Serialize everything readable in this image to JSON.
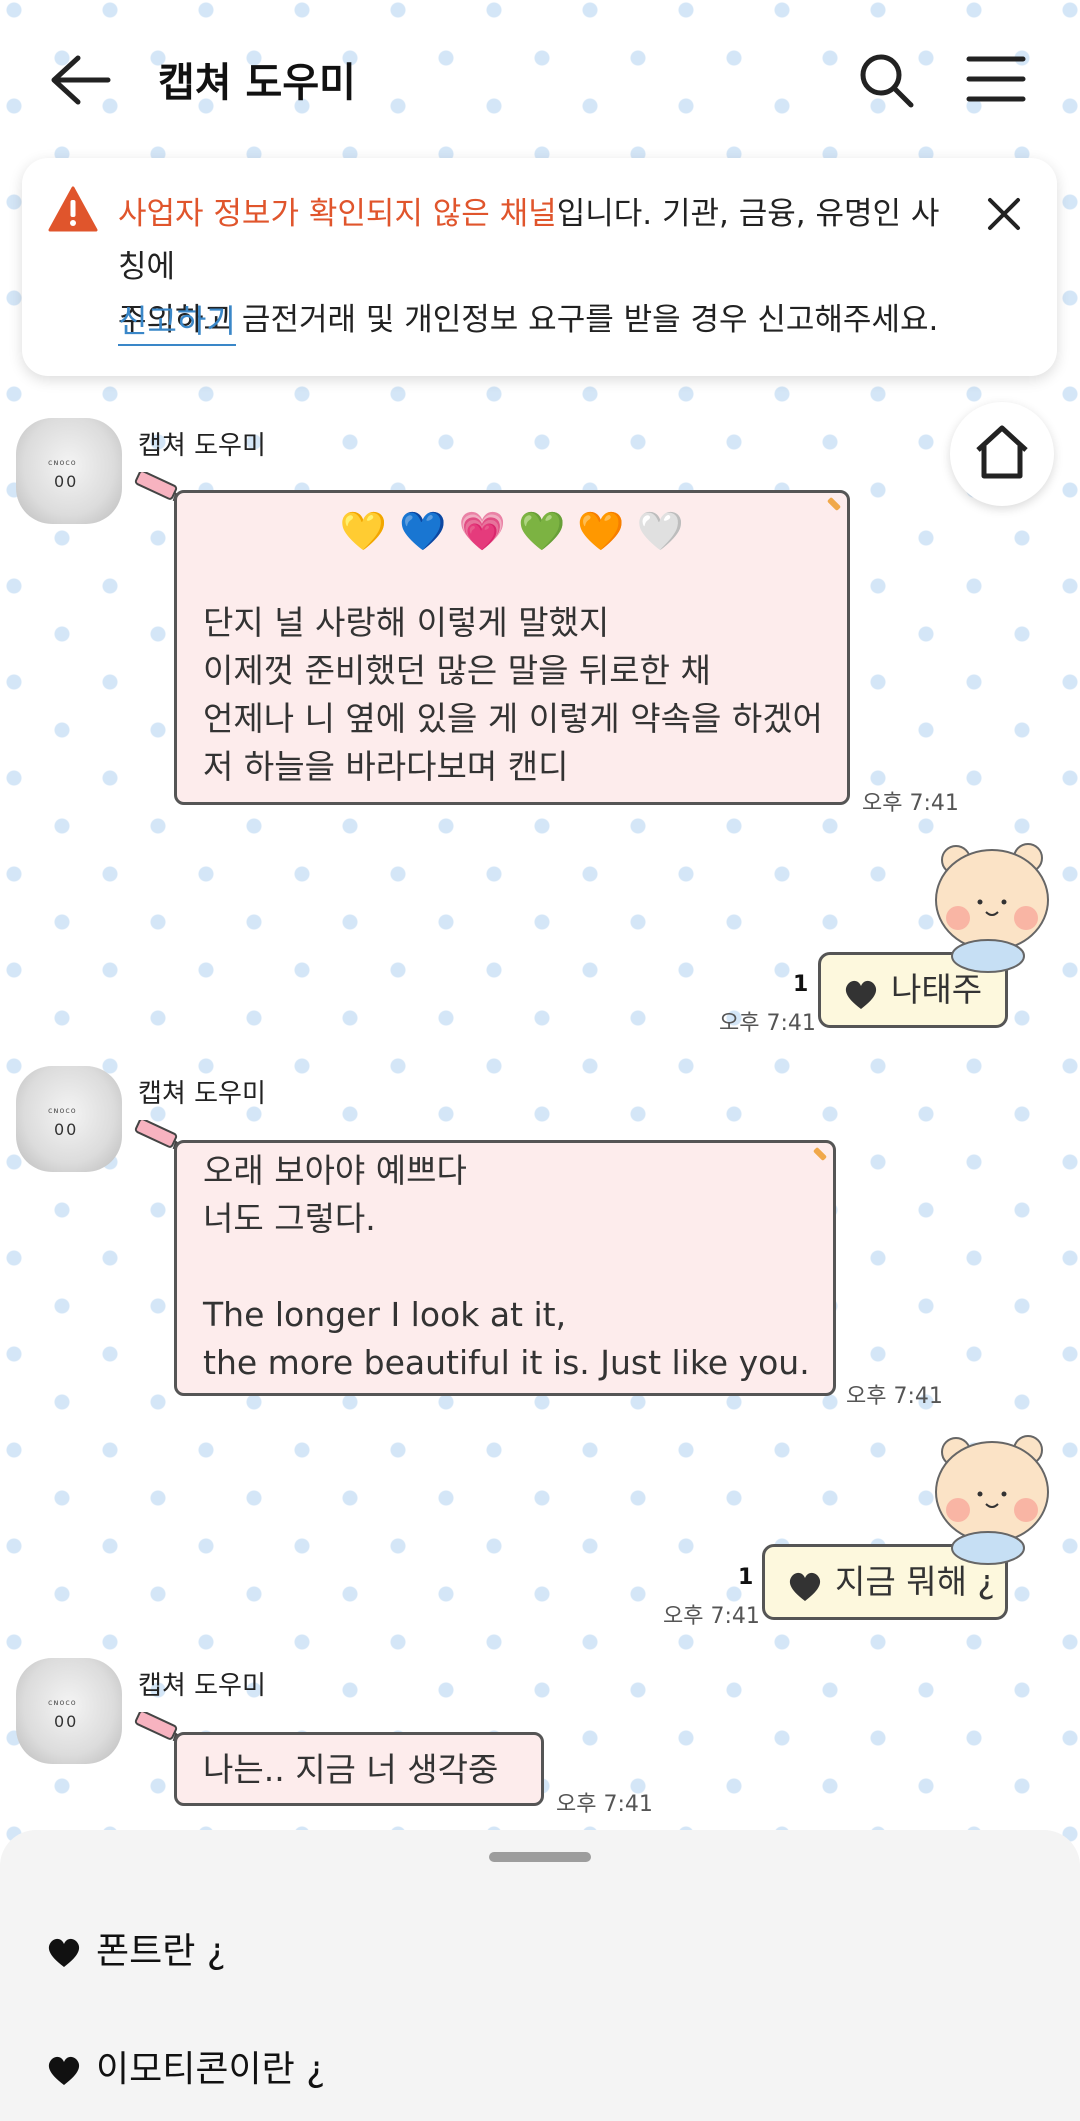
{
  "header": {
    "title": "캡쳐 도우미"
  },
  "notice": {
    "highlight": "사업자 정보가 확인되지 않은 채널",
    "text_line1_rest": "입니다. 기관, 금융, 유명인 사칭에",
    "text_line2": "주의하고 금전거래 및 개인정보 요구를 받을 경우 신고해주세요.",
    "report_label": "신고하기"
  },
  "messages": [
    {
      "sender": "캡쳐 도우미",
      "emoji_row": "💛 💙 💗 💚 🧡 🤍",
      "lines": [
        "단지 널 사랑해 이렇게 말했지",
        "이제껏 준비했던 많은 말을 뒤로한 채",
        "언제나 니 옆에 있을 게 이렇게 약속을 하겠어",
        "저 하늘을 바라다보며 캔디"
      ],
      "time": "오후 7:41"
    },
    {
      "text": "나태주",
      "time": "오후 7:41",
      "unread": "1"
    },
    {
      "sender": "캡쳐 도우미",
      "lines": [
        "오래 보아야 예쁘다",
        "너도 그렇다.",
        "",
        "The longer I look at it,",
        "the more beautiful it is. Just like you."
      ],
      "time": "오후 7:41"
    },
    {
      "text": "지금 뭐해 ¿",
      "time": "오후 7:41",
      "unread": "1"
    },
    {
      "sender": "캡쳐 도우미",
      "text": "나는.. 지금 너 생각중 >_<",
      "time": "오후 7:41"
    }
  ],
  "avatar": {
    "brand": "ᴄɴᴏᴄᴏ",
    "eyes": "00"
  },
  "sheet": {
    "items": [
      "폰트란 ¿",
      "이모티콘이란 ¿"
    ]
  },
  "colors": {
    "accent_warning": "#e0552c",
    "link": "#3a87c8",
    "bubble_in": "#fdecec",
    "bubble_out": "#fdf8dd"
  }
}
